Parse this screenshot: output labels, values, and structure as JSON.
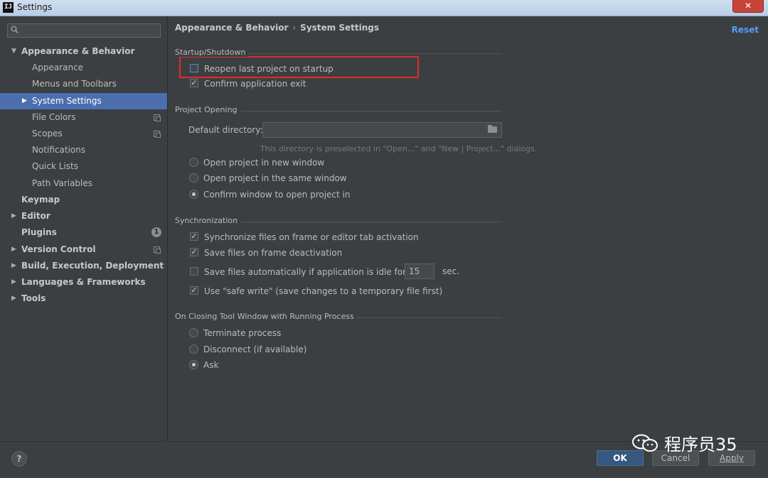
{
  "window": {
    "icon_text": "IJ",
    "title": "Settings",
    "close_symbol": "✕"
  },
  "sidebar": {
    "search_placeholder": "",
    "items": [
      {
        "label": "Appearance & Behavior",
        "arrow": "▼"
      },
      {
        "label": "Appearance"
      },
      {
        "label": "Menus and Toolbars"
      },
      {
        "label": "System Settings",
        "arrow": "▶"
      },
      {
        "label": "File Colors"
      },
      {
        "label": "Scopes"
      },
      {
        "label": "Notifications"
      },
      {
        "label": "Quick Lists"
      },
      {
        "label": "Path Variables"
      },
      {
        "label": "Keymap"
      },
      {
        "label": "Editor",
        "arrow": "▶"
      },
      {
        "label": "Plugins",
        "badge": "1"
      },
      {
        "label": "Version Control",
        "arrow": "▶"
      },
      {
        "label": "Build, Execution, Deployment",
        "arrow": "▶"
      },
      {
        "label": "Languages & Frameworks",
        "arrow": "▶"
      },
      {
        "label": "Tools",
        "arrow": "▶"
      }
    ]
  },
  "breadcrumb": {
    "parent": "Appearance & Behavior",
    "separator": "›",
    "current": "System Settings"
  },
  "reset_label": "Reset",
  "startup": {
    "title": "Startup/Shutdown",
    "reopen_last_project": {
      "label": "Reopen last project on startup",
      "checked": false
    },
    "confirm_exit": {
      "label": "Confirm application exit",
      "checked": true
    }
  },
  "project_opening": {
    "title": "Project Opening",
    "default_directory_label": "Default directory:",
    "default_directory_value": "",
    "hint": "This directory is preselected in \"Open...\" and \"New | Project...\" dialogs.",
    "options": [
      {
        "label": "Open project in new window",
        "selected": false
      },
      {
        "label": "Open project in the same window",
        "selected": false
      },
      {
        "label": "Confirm window to open project in",
        "selected": true
      }
    ]
  },
  "synchronization": {
    "title": "Synchronization",
    "sync_files": {
      "label": "Synchronize files on frame or editor tab activation",
      "checked": true
    },
    "save_on_deactivation": {
      "label": "Save files on frame deactivation",
      "checked": true
    },
    "save_idle": {
      "label": "Save files automatically if application is idle for",
      "checked": false,
      "value": "15",
      "unit": "sec."
    },
    "safe_write": {
      "label": "Use \"safe write\" (save changes to a temporary file first)",
      "checked": true
    }
  },
  "closing": {
    "title": "On Closing Tool Window with Running Process",
    "options": [
      {
        "label": "Terminate process",
        "selected": false
      },
      {
        "label": "Disconnect (if available)",
        "selected": false
      },
      {
        "label": "Ask",
        "selected": true
      }
    ]
  },
  "footer": {
    "help_label": "?",
    "ok_label": "OK",
    "cancel_label": "Cancel",
    "apply_label": "Apply"
  },
  "watermark": {
    "text": "程序员35"
  },
  "colors": {
    "background": "#3c3f41",
    "selection": "#4b6eaf",
    "link": "#589df6",
    "highlight_box": "#e02b2b",
    "primary_button": "#365880"
  }
}
